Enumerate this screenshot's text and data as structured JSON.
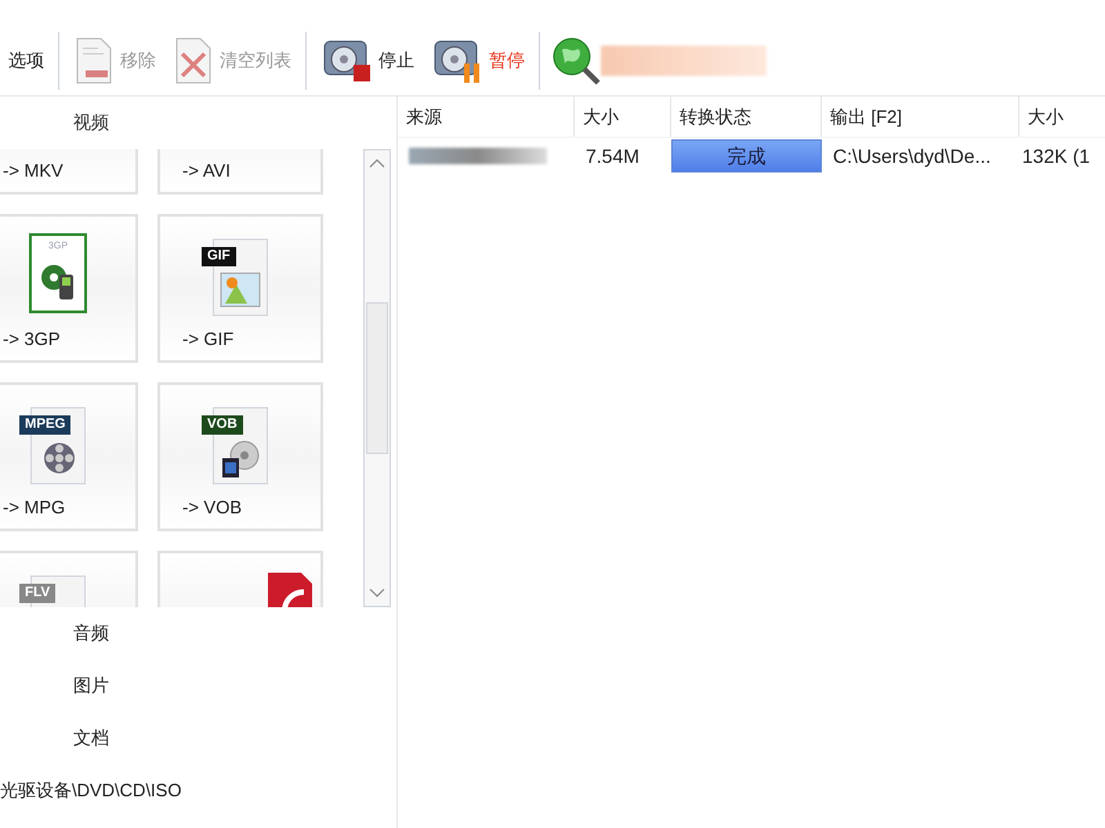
{
  "toolbar": [
    {
      "label": "选项",
      "disabled": false,
      "kind": "none"
    },
    {
      "label": "移除",
      "disabled": true,
      "kind": "remove"
    },
    {
      "label": "清空列表",
      "disabled": true,
      "kind": "clear"
    },
    {
      "label": "停止",
      "disabled": false,
      "kind": "stop"
    },
    {
      "label": "暂停",
      "disabled": false,
      "kind": "pause",
      "color": "#e8361c"
    }
  ],
  "categories": [
    {
      "label": "视频",
      "expanded": true,
      "tiles": [
        {
          "label": "-> MKV",
          "kind": "none",
          "selected": false
        },
        {
          "label": "-> AVI",
          "kind": "none",
          "selected": false
        },
        {
          "label": "-> 3GP",
          "kind": "phone",
          "badge": "3GP",
          "selected": false
        },
        {
          "label": "-> GIF",
          "kind": "image",
          "badge": "GIF",
          "selected": false
        },
        {
          "label": "-> MPG",
          "kind": "reel",
          "badge": "MPEG",
          "selected": false
        },
        {
          "label": "-> VOB",
          "kind": "disc",
          "badge": "VOB",
          "selected": false
        },
        {
          "kind": "chart",
          "badge": "FLV",
          "selected": false
        },
        {
          "kind": "red",
          "selected": false
        }
      ]
    },
    {
      "label": "音频",
      "expanded": false
    },
    {
      "label": "图片",
      "expanded": false
    },
    {
      "label": "文档",
      "expanded": false
    },
    {
      "label": "光驱设备\\DVD\\CD\\ISO",
      "expanded": false
    }
  ],
  "table": {
    "columns": [
      "来源",
      "大小",
      "转换状态",
      "输出 [F2]",
      "大小"
    ],
    "rows": [
      {
        "size": "7.54M",
        "status": "完成",
        "level": 1,
        "output": "C:\\Users\\dyd\\De...",
        "size_2": "132K  (1"
      }
    ]
  }
}
